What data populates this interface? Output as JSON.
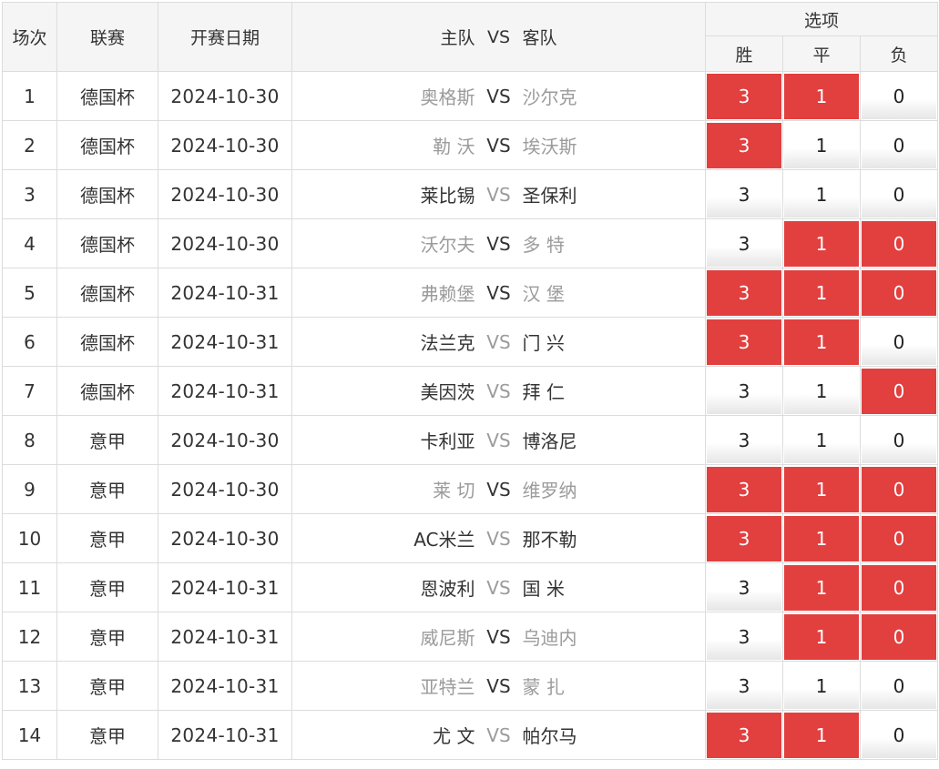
{
  "headers": {
    "index": "场次",
    "league": "联赛",
    "date": "开赛日期",
    "home": "主队",
    "vs": "VS",
    "away": "客队",
    "options": "选项",
    "win": "胜",
    "draw": "平",
    "loss": "负"
  },
  "colors": {
    "selected": "#e23f3f",
    "dark_text": "#333333",
    "grey_text": "#9b9b9b"
  },
  "rows": [
    {
      "index": "1",
      "league": "德国杯",
      "date": "2024-10-30",
      "home": "奥格斯",
      "away": "沙尔克",
      "home_style": "grey",
      "vs_style": "dark",
      "away_style": "grey",
      "win": "3",
      "draw": "1",
      "loss": "0",
      "win_sel": true,
      "draw_sel": true,
      "loss_sel": false
    },
    {
      "index": "2",
      "league": "德国杯",
      "date": "2024-10-30",
      "home": "勒 沃",
      "away": "埃沃斯",
      "home_style": "grey",
      "vs_style": "dark",
      "away_style": "grey",
      "win": "3",
      "draw": "1",
      "loss": "0",
      "win_sel": true,
      "draw_sel": false,
      "loss_sel": false
    },
    {
      "index": "3",
      "league": "德国杯",
      "date": "2024-10-30",
      "home": "莱比锡",
      "away": "圣保利",
      "home_style": "dark",
      "vs_style": "grey",
      "away_style": "dark",
      "win": "3",
      "draw": "1",
      "loss": "0",
      "win_sel": false,
      "draw_sel": false,
      "loss_sel": false
    },
    {
      "index": "4",
      "league": "德国杯",
      "date": "2024-10-30",
      "home": "沃尔夫",
      "away": "多 特",
      "home_style": "grey",
      "vs_style": "dark",
      "away_style": "grey",
      "win": "3",
      "draw": "1",
      "loss": "0",
      "win_sel": false,
      "draw_sel": true,
      "loss_sel": true
    },
    {
      "index": "5",
      "league": "德国杯",
      "date": "2024-10-31",
      "home": "弗赖堡",
      "away": "汉 堡",
      "home_style": "grey",
      "vs_style": "dark",
      "away_style": "grey",
      "win": "3",
      "draw": "1",
      "loss": "0",
      "win_sel": true,
      "draw_sel": true,
      "loss_sel": true
    },
    {
      "index": "6",
      "league": "德国杯",
      "date": "2024-10-31",
      "home": "法兰克",
      "away": "门 兴",
      "home_style": "dark",
      "vs_style": "grey",
      "away_style": "dark",
      "win": "3",
      "draw": "1",
      "loss": "0",
      "win_sel": true,
      "draw_sel": true,
      "loss_sel": false
    },
    {
      "index": "7",
      "league": "德国杯",
      "date": "2024-10-31",
      "home": "美因茨",
      "away": "拜 仁",
      "home_style": "dark",
      "vs_style": "grey",
      "away_style": "dark",
      "win": "3",
      "draw": "1",
      "loss": "0",
      "win_sel": false,
      "draw_sel": false,
      "loss_sel": true
    },
    {
      "index": "8",
      "league": "意甲",
      "date": "2024-10-30",
      "home": "卡利亚",
      "away": "博洛尼",
      "home_style": "dark",
      "vs_style": "grey",
      "away_style": "dark",
      "win": "3",
      "draw": "1",
      "loss": "0",
      "win_sel": false,
      "draw_sel": false,
      "loss_sel": false
    },
    {
      "index": "9",
      "league": "意甲",
      "date": "2024-10-30",
      "home": "莱 切",
      "away": "维罗纳",
      "home_style": "grey",
      "vs_style": "dark",
      "away_style": "grey",
      "win": "3",
      "draw": "1",
      "loss": "0",
      "win_sel": true,
      "draw_sel": true,
      "loss_sel": true
    },
    {
      "index": "10",
      "league": "意甲",
      "date": "2024-10-30",
      "home": "AC米兰",
      "away": "那不勒",
      "home_style": "dark",
      "vs_style": "grey",
      "away_style": "dark",
      "win": "3",
      "draw": "1",
      "loss": "0",
      "win_sel": true,
      "draw_sel": true,
      "loss_sel": true
    },
    {
      "index": "11",
      "league": "意甲",
      "date": "2024-10-31",
      "home": "恩波利",
      "away": "国 米",
      "home_style": "dark",
      "vs_style": "grey",
      "away_style": "dark",
      "win": "3",
      "draw": "1",
      "loss": "0",
      "win_sel": false,
      "draw_sel": true,
      "loss_sel": true
    },
    {
      "index": "12",
      "league": "意甲",
      "date": "2024-10-31",
      "home": "威尼斯",
      "away": "乌迪内",
      "home_style": "grey",
      "vs_style": "dark",
      "away_style": "grey",
      "win": "3",
      "draw": "1",
      "loss": "0",
      "win_sel": false,
      "draw_sel": true,
      "loss_sel": true
    },
    {
      "index": "13",
      "league": "意甲",
      "date": "2024-10-31",
      "home": "亚特兰",
      "away": "蒙 扎",
      "home_style": "grey",
      "vs_style": "dark",
      "away_style": "grey",
      "win": "3",
      "draw": "1",
      "loss": "0",
      "win_sel": false,
      "draw_sel": false,
      "loss_sel": false
    },
    {
      "index": "14",
      "league": "意甲",
      "date": "2024-10-31",
      "home": "尤 文",
      "away": "帕尔马",
      "home_style": "dark",
      "vs_style": "grey",
      "away_style": "dark",
      "win": "3",
      "draw": "1",
      "loss": "0",
      "win_sel": true,
      "draw_sel": true,
      "loss_sel": false
    }
  ]
}
